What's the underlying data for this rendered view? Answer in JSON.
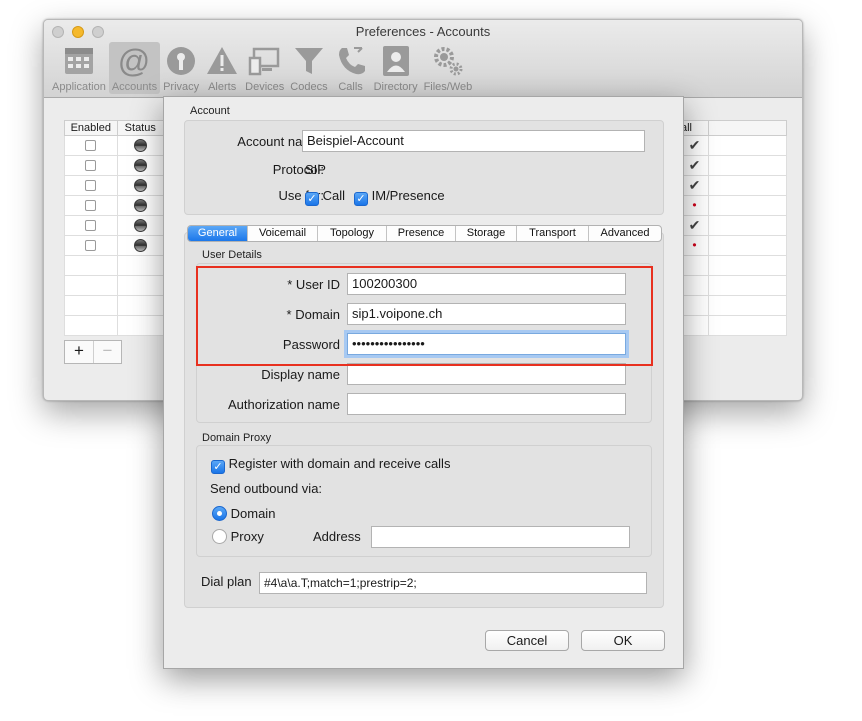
{
  "window": {
    "title": "Preferences - Accounts"
  },
  "toolbar": {
    "items": [
      {
        "label": "Application",
        "icon": "application-icon"
      },
      {
        "label": "Accounts",
        "icon": "at-sign-icon",
        "active": true
      },
      {
        "label": "Privacy",
        "icon": "privacy-icon"
      },
      {
        "label": "Alerts",
        "icon": "alert-triangle-icon"
      },
      {
        "label": "Devices",
        "icon": "devices-icon"
      },
      {
        "label": "Codecs",
        "icon": "funnel-icon"
      },
      {
        "label": "Calls",
        "icon": "phone-icon"
      },
      {
        "label": "Directory",
        "icon": "contact-card-icon"
      },
      {
        "label": "Files/Web",
        "icon": "gears-icon"
      }
    ]
  },
  "accounts_table": {
    "headers": [
      "Enabled",
      "Status"
    ],
    "call_header": "Call",
    "call_header_visible": "all"
  },
  "account": {
    "section_title": "Account",
    "name_label": "Account name:",
    "name_value": "Beispiel-Account",
    "protocol_label": "Protocol:",
    "protocol_value": "SIP",
    "use_for_label": "Use for:",
    "call_label": "Call",
    "im_label": "IM/Presence"
  },
  "tabs": [
    "General",
    "Voicemail",
    "Topology",
    "Presence",
    "Storage",
    "Transport",
    "Advanced"
  ],
  "user_details": {
    "section_title": "User Details",
    "user_id_label": "* User ID",
    "user_id_value": "100200300",
    "domain_label": "* Domain",
    "domain_value": "sip1.voipone.ch",
    "password_label": "Password",
    "password_value": "••••••••••••••••",
    "display_name_label": "Display name",
    "display_name_value": "",
    "auth_name_label": "Authorization name",
    "auth_name_value": ""
  },
  "domain_proxy": {
    "section_title": "Domain Proxy",
    "register_label": "Register with domain and receive calls",
    "send_outbound_label": "Send outbound via:",
    "domain_option": "Domain",
    "proxy_option": "Proxy",
    "address_label": "Address",
    "address_value": ""
  },
  "dial_plan": {
    "label": "Dial plan",
    "value": "#4\\a\\a.T;match=1;prestrip=2;"
  },
  "buttons": {
    "cancel": "Cancel",
    "ok": "OK"
  },
  "colors": {
    "accent": "#1a75e8",
    "highlight_frame": "#e8301f",
    "tab_active": "#3d8ef0"
  }
}
